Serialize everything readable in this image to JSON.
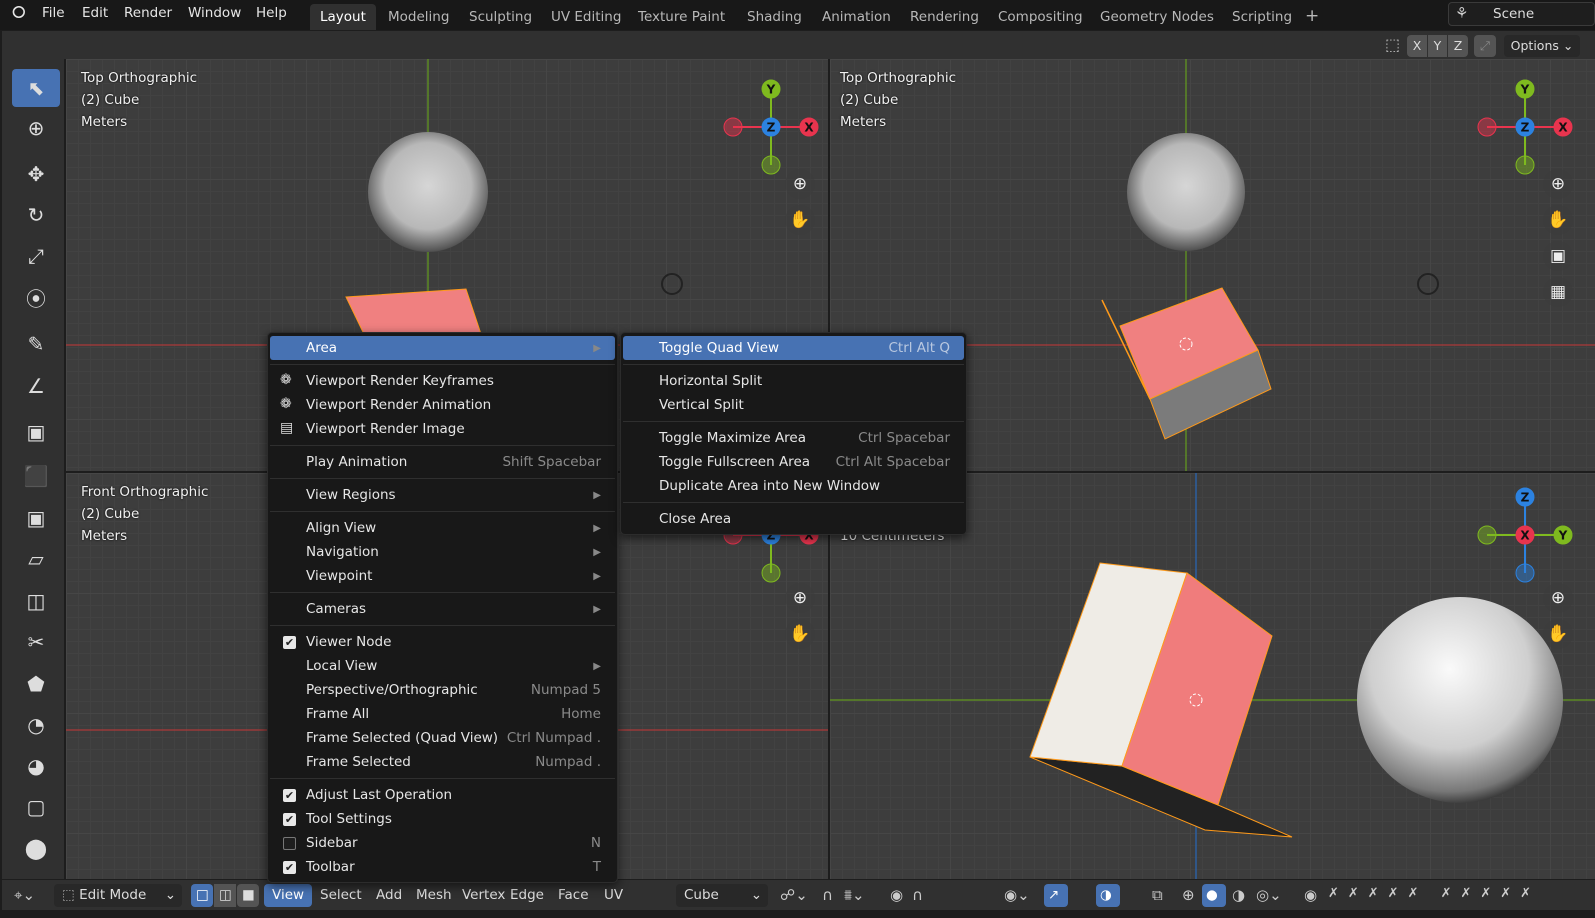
{
  "topbar": {
    "menus": [
      "File",
      "Edit",
      "Render",
      "Window",
      "Help"
    ],
    "tabs": [
      "Layout",
      "Modeling",
      "Sculpting",
      "UV Editing",
      "Texture Paint",
      "Shading",
      "Animation",
      "Rendering",
      "Compositing",
      "Geometry Nodes",
      "Scripting"
    ],
    "active_tab": "Layout",
    "add_tab": "+",
    "scene": "Scene"
  },
  "header": {
    "x": "X",
    "y": "Y",
    "z": "Z",
    "options": "Options"
  },
  "toolbar": {
    "tools": [
      "select-box",
      "cursor",
      "move",
      "rotate",
      "scale",
      "transform",
      "annotate",
      "measure",
      "add-cube",
      "extrude-region",
      "inset-faces",
      "bevel",
      "loop-cut",
      "knife",
      "poly-build",
      "spin",
      "smooth",
      "edge-slide",
      "shrink-fatten",
      "shear"
    ],
    "active": "select-box"
  },
  "viewports": {
    "top_left": {
      "view": "Top Orthographic",
      "object": "(2) Cube",
      "units": "Meters"
    },
    "top_right": {
      "view": "Top Orthographic",
      "object": "(2) Cube",
      "units": "Meters"
    },
    "bottom_left": {
      "view": "Front Orthographic",
      "object": "(2) Cube",
      "units": "Meters"
    },
    "bottom_right": {
      "units": "10 Centimeters"
    },
    "gizmo": {
      "x": "X",
      "y": "Y",
      "z": "Z"
    },
    "colors": {
      "x": "#e8344e",
      "y": "#7fba1f",
      "z": "#2c82e0",
      "mesh": "#f08080",
      "selected": "#ff9a1a"
    }
  },
  "view_menu": {
    "items": [
      {
        "label": "Area",
        "submenu": true,
        "highlighted": true
      },
      {
        "sep": true
      },
      {
        "label": "Viewport Render Keyframes",
        "icon": "render-animation-icon"
      },
      {
        "label": "Viewport Render Animation",
        "icon": "render-animation-icon"
      },
      {
        "label": "Viewport Render Image",
        "icon": "render-still-icon"
      },
      {
        "sep": true
      },
      {
        "label": "Play Animation",
        "shortcut": "Shift Spacebar"
      },
      {
        "sep": true
      },
      {
        "label": "View Regions",
        "submenu": true
      },
      {
        "sep": true
      },
      {
        "label": "Align View",
        "submenu": true
      },
      {
        "label": "Navigation",
        "submenu": true
      },
      {
        "label": "Viewpoint",
        "submenu": true
      },
      {
        "sep": true
      },
      {
        "label": "Cameras",
        "submenu": true
      },
      {
        "sep": true
      },
      {
        "label": "Viewer Node",
        "checked": true
      },
      {
        "label": "Local View",
        "submenu": true
      },
      {
        "label": "Perspective/Orthographic",
        "shortcut": "Numpad 5"
      },
      {
        "label": "Frame All",
        "shortcut": "Home"
      },
      {
        "label": "Frame Selected (Quad View)",
        "shortcut": "Ctrl Numpad ."
      },
      {
        "label": "Frame Selected",
        "shortcut": "Numpad ."
      },
      {
        "sep": true
      },
      {
        "label": "Adjust Last Operation",
        "checked": true
      },
      {
        "label": "Tool Settings",
        "checked": true
      },
      {
        "label": "Sidebar",
        "checked": false,
        "shortcut": "N"
      },
      {
        "label": "Toolbar",
        "checked": true,
        "shortcut": "T"
      }
    ]
  },
  "area_menu": {
    "items": [
      {
        "label": "Toggle Quad View",
        "shortcut": "Ctrl Alt Q",
        "highlighted": true
      },
      {
        "sep": true
      },
      {
        "label": "Horizontal Split"
      },
      {
        "label": "Vertical Split"
      },
      {
        "sep": true
      },
      {
        "label": "Toggle Maximize Area",
        "shortcut": "Ctrl Spacebar"
      },
      {
        "label": "Toggle Fullscreen Area",
        "shortcut": "Ctrl Alt Spacebar"
      },
      {
        "label": "Duplicate Area into New Window"
      },
      {
        "sep": true
      },
      {
        "label": "Close Area"
      }
    ]
  },
  "bottombar": {
    "mode": "Edit Mode",
    "menus": [
      "View",
      "Select",
      "Add",
      "Mesh",
      "Vertex",
      "Edge",
      "Face",
      "UV"
    ],
    "active_menu": "View",
    "object": "Cube",
    "select_mode": "vertex"
  }
}
